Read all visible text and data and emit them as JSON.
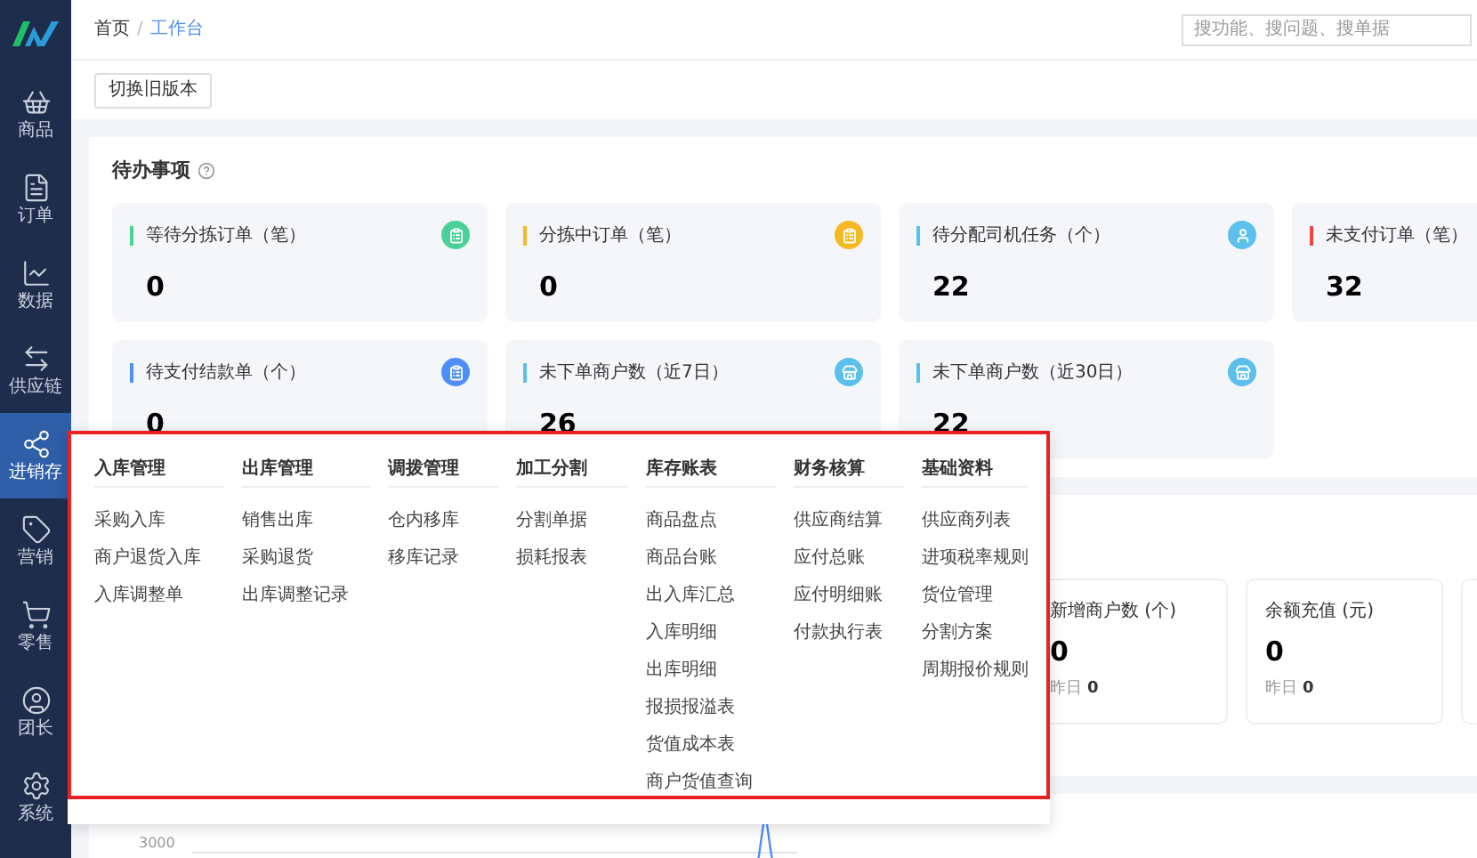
{
  "sidebar": {
    "items": [
      {
        "label": "商品",
        "selected": false
      },
      {
        "label": "订单",
        "selected": false
      },
      {
        "label": "数据",
        "selected": false
      },
      {
        "label": "供应链",
        "selected": false
      },
      {
        "label": "进销存",
        "selected": true
      },
      {
        "label": "营销",
        "selected": false
      },
      {
        "label": "零售",
        "selected": false
      },
      {
        "label": "团长",
        "selected": false
      },
      {
        "label": "系统",
        "selected": false
      }
    ]
  },
  "breadcrumb": [
    {
      "label": "首页",
      "selected": false
    },
    {
      "label": "工作台",
      "selected": true
    }
  ],
  "breadcrumb_separator": "/",
  "search": {
    "placeholder": "搜功能、搜问题、搜单据"
  },
  "toolbar": {
    "button": "切换旧版本"
  },
  "todo": {
    "title": "待办事项",
    "cards": [
      {
        "label": "等待分拣订单（笔）",
        "value": "0",
        "color": "#4cd09a",
        "kind": "order"
      },
      {
        "label": "分拣中订单（笔）",
        "value": "0",
        "color": "#f5b924",
        "kind": "order"
      },
      {
        "label": "待分配司机任务（个）",
        "value": "22",
        "color": "#5bc0eb",
        "kind": "driver"
      },
      {
        "label": "未支付订单（笔）",
        "value": "32",
        "color": "#ef4444"
      },
      {
        "label": "待支付结款单（个）",
        "value": "0",
        "color": "#4f8ef7",
        "kind": "order"
      },
      {
        "label": "未下单商户数（近7日）",
        "value": "26",
        "color": "#5bc0eb",
        "kind": "merchant"
      },
      {
        "label": "未下单商户数（近30日）",
        "value": "22",
        "color": "#5bc0eb",
        "kind": "merchant"
      }
    ]
  },
  "stats": [
    {
      "kind": "stat",
      "label": "新增商户数 (个)",
      "value": "0",
      "prev_label": "昨日",
      "prev_value": "0"
    },
    {
      "kind": "stat",
      "label": "余额充值 (元)",
      "value": "0",
      "prev_label": "昨日",
      "prev_value": "0"
    },
    {
      "kind": "blank"
    }
  ],
  "chart": {
    "tick": "3000"
  },
  "menu": {
    "columns": [
      {
        "title": "入库管理",
        "items": [
          "采购入库",
          "商户退货入库",
          "入库调整单"
        ]
      },
      {
        "title": "出库管理",
        "items": [
          "销售出库",
          "采购退货",
          "出库调整记录"
        ]
      },
      {
        "title": "调拨管理",
        "items": [
          "仓内移库",
          "移库记录"
        ]
      },
      {
        "title": "加工分割",
        "items": [
          "分割单据",
          "损耗报表"
        ]
      },
      {
        "title": "库存账表",
        "items": [
          "商品盘点",
          "商品台账",
          "出入库汇总",
          "入库明细",
          "出库明细",
          "报损报溢表",
          "货值成本表",
          "商户货值查询"
        ]
      },
      {
        "title": "财务核算",
        "items": [
          "供应商结算",
          "应付总账",
          "应付明细账",
          "付款执行表"
        ]
      },
      {
        "title": "基础资料",
        "items": [
          "供应商列表",
          "进项税率规则",
          "货位管理",
          "分割方案",
          "周期报价规则"
        ]
      }
    ]
  }
}
